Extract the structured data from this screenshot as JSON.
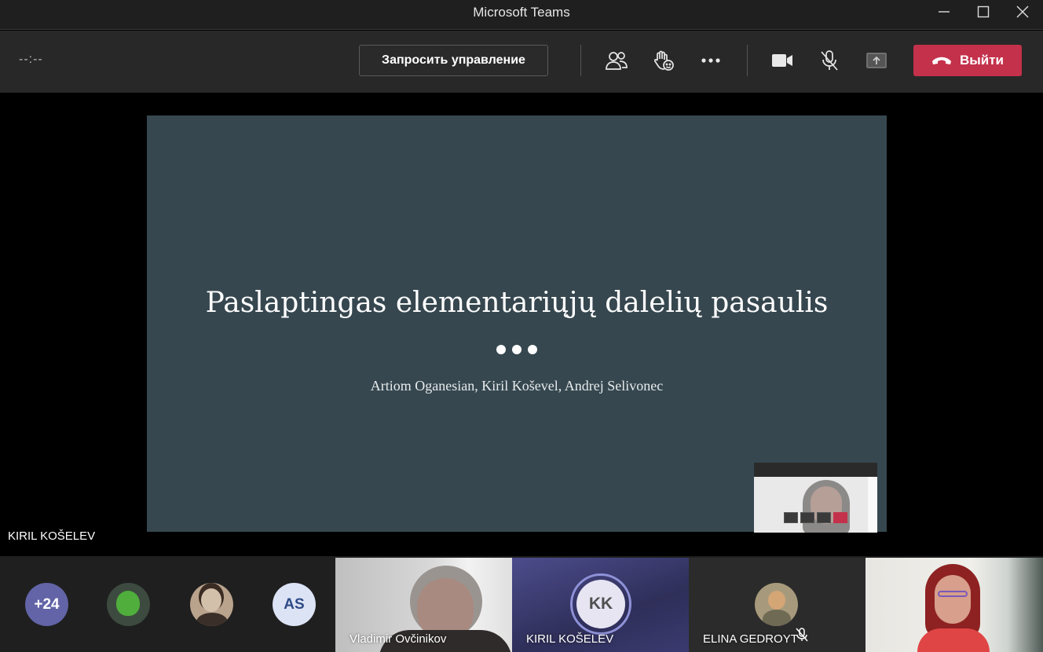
{
  "window": {
    "title": "Microsoft Teams"
  },
  "toolbar": {
    "timer": "--:--",
    "request_control_label": "Запросить управление",
    "leave_label": "Выйти"
  },
  "slide": {
    "title": "Paslaptingas elementariųjų dalelių pasaulis",
    "authors": "Artiom Oganesian, Kiril Koševel, Andrej Selivonec"
  },
  "stage": {
    "presenter_name": "KIRIL KOŠELEV"
  },
  "participants": {
    "overflow_count": "+24",
    "initials_as": "AS",
    "tiles": [
      {
        "name": "Vladimir Ovčinikov"
      },
      {
        "name": "KIRIL KOŠELEV",
        "initials": "KK"
      },
      {
        "name": "ELINA GEDROYT"
      }
    ]
  },
  "colors": {
    "leave": "#c4314b",
    "accent": "#6264a7",
    "slide_bg": "#36474f"
  }
}
